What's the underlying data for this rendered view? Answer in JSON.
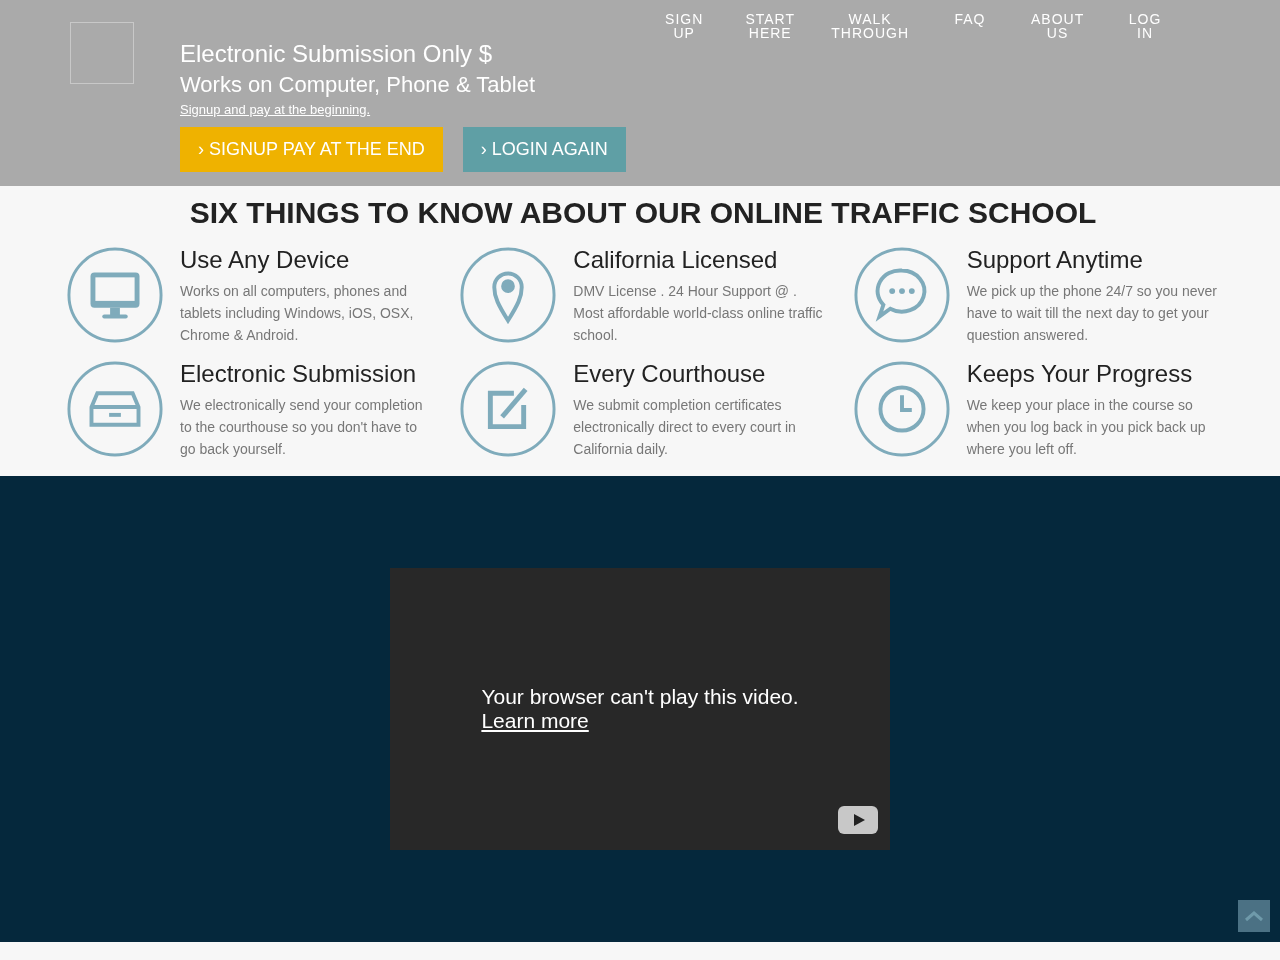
{
  "header": {
    "nav": [
      "SIGN UP",
      "START HERE",
      "WALK THROUGH",
      "FAQ",
      "ABOUT US",
      "LOG IN"
    ]
  },
  "hero": {
    "title": "Electronic Submission Only $",
    "subtitle": "Works on Computer, Phone & Tablet",
    "link": "Signup and pay at the beginning.",
    "buttons": [
      {
        "kind": "primary",
        "chevron": "›",
        "label": "SIGNUP PAY AT THE END"
      },
      {
        "kind": "secondary",
        "chevron": "›",
        "label": "LOGIN AGAIN"
      }
    ]
  },
  "features": {
    "title": "SIX THINGS TO KNOW ABOUT OUR ONLINE TRAFFIC SCHOOL",
    "items": [
      {
        "kind": "monitor",
        "title": "Use Any Device",
        "text": "Works on all computers, phones and tablets including Windows, iOS, OSX, Chrome & Android."
      },
      {
        "kind": "pin",
        "title": "California Licensed",
        "text": "DMV License . 24 Hour Support @ . Most affordable world-class online traffic school."
      },
      {
        "kind": "chat",
        "title": "Support Anytime",
        "text": "We pick up the phone 24/7 so you never have to wait till the next day to get your question answered."
      },
      {
        "kind": "tray",
        "title": "Electronic Submission",
        "text": "We electronically send your completion to the courthouse so you don't have to go back yourself."
      },
      {
        "kind": "edit",
        "title": "Every Courthouse",
        "text": "We submit completion certificates electronically direct to every court in California daily."
      },
      {
        "kind": "clock",
        "title": "Keeps Your Progress",
        "text": "We keep your place in the course so when you log back in you pick back up where you left off."
      }
    ]
  },
  "video": {
    "message": "Your browser can't play this video.",
    "link": "Learn more"
  }
}
